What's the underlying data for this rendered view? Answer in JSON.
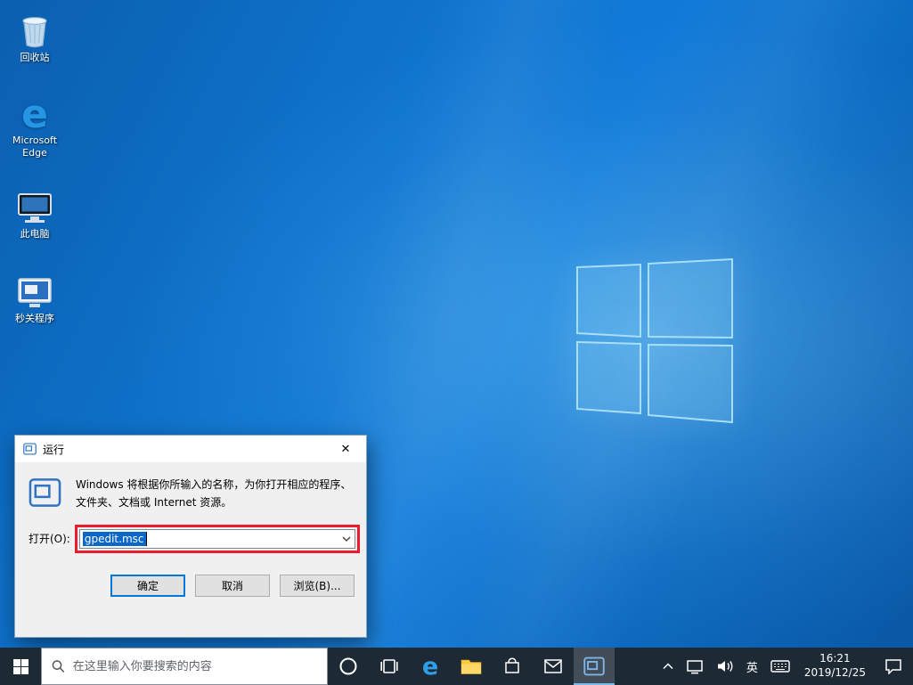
{
  "icons_glyphs": {
    "edge": "e",
    "close": "✕"
  },
  "desktop": {
    "icons": [
      {
        "label": "回收站"
      },
      {
        "label": "Microsoft Edge"
      },
      {
        "label": "此电脑"
      },
      {
        "label": "秒关程序"
      }
    ]
  },
  "run_dialog": {
    "title": "运行",
    "description": "Windows 将根据你所输入的名称，为你打开相应的程序、文件夹、文档或 Internet 资源。",
    "open_label": "打开(O):",
    "input_value": "gpedit.msc",
    "ok": "确定",
    "cancel": "取消",
    "browse": "浏览(B)...",
    "annotation_color": "#e81c2a"
  },
  "taskbar": {
    "search_placeholder": "在这里输入你要搜索的内容",
    "tray": {
      "ime": "英",
      "time": "16:21",
      "date": "2019/12/25"
    }
  },
  "colors": {
    "accent": "#0078d7",
    "selection": "#0a66c8",
    "taskbar_bg": "#1e2936",
    "wallpaper": "#107ad8"
  }
}
